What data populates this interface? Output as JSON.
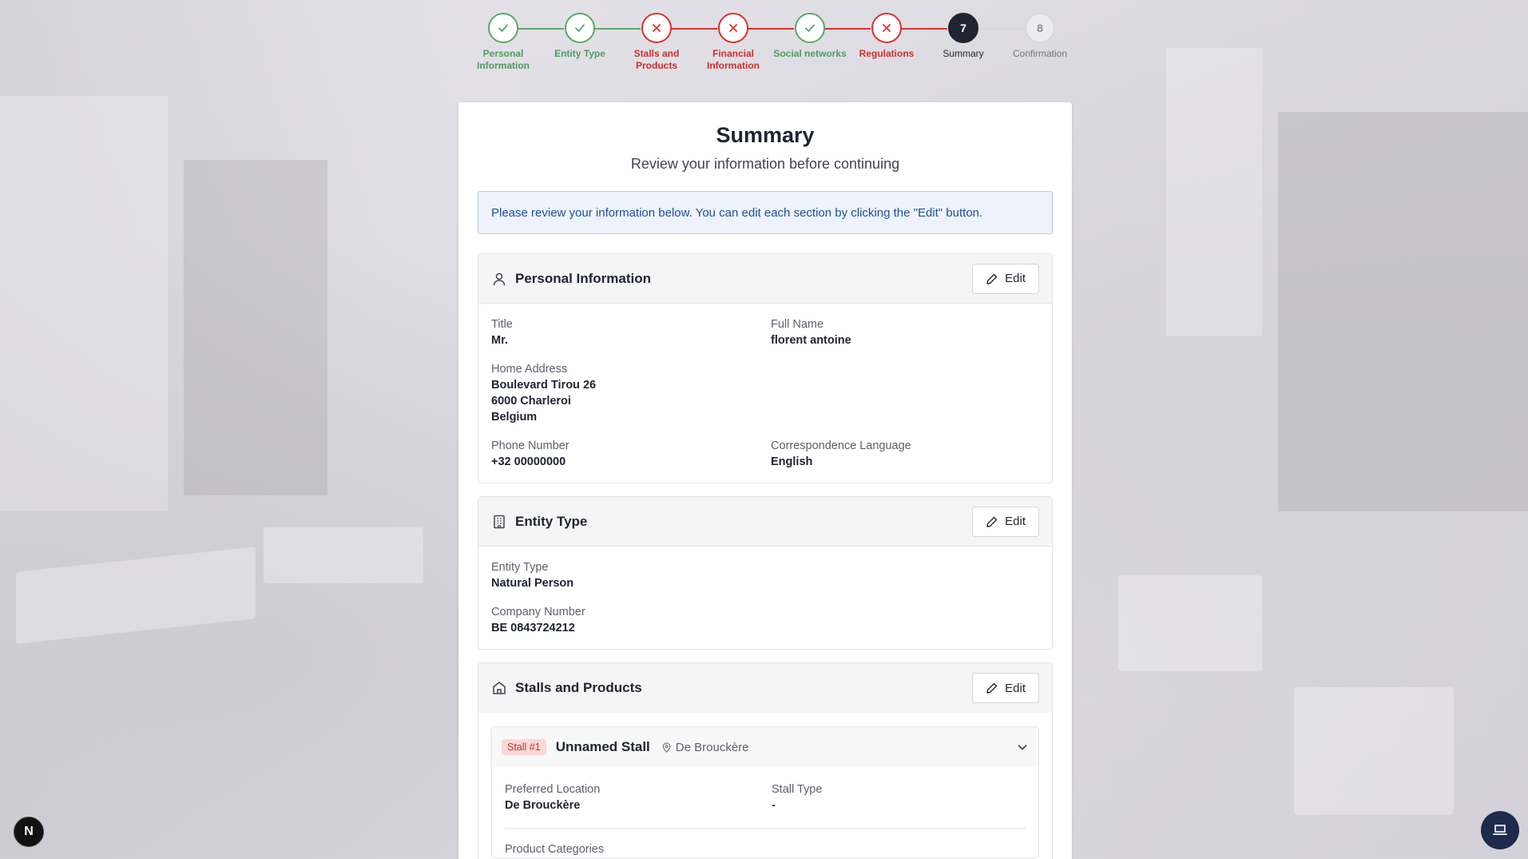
{
  "stepper": {
    "steps": [
      {
        "label": "Personal Information",
        "status": "ok",
        "marker": "check-icon"
      },
      {
        "label": "Entity Type",
        "status": "ok",
        "marker": "check-icon"
      },
      {
        "label": "Stalls and Products",
        "status": "error",
        "marker": "x-icon"
      },
      {
        "label": "Financial Information",
        "status": "error",
        "marker": "x-icon"
      },
      {
        "label": "Social networks",
        "status": "ok",
        "marker": "check-icon"
      },
      {
        "label": "Regulations",
        "status": "error",
        "marker": "x-icon"
      },
      {
        "label": "Summary",
        "status": "current",
        "number": "7"
      },
      {
        "label": "Confirmation",
        "status": "todo",
        "number": "8"
      }
    ]
  },
  "page": {
    "title": "Summary",
    "subtitle": "Review your information before continuing",
    "notice": "Please review your information below. You can edit each section by clicking the \"Edit\" button."
  },
  "edit_label": "Edit",
  "personal": {
    "heading": "Personal Information",
    "title_label": "Title",
    "title_value": "Mr.",
    "fullname_label": "Full Name",
    "fullname_value": "florent antoine",
    "address_label": "Home Address",
    "address_line1": "Boulevard Tirou 26",
    "address_line2": "6000 Charleroi",
    "address_line3": "Belgium",
    "phone_label": "Phone Number",
    "phone_value": "+32 00000000",
    "language_label": "Correspondence Language",
    "language_value": "English"
  },
  "entity": {
    "heading": "Entity Type",
    "type_label": "Entity Type",
    "type_value": "Natural Person",
    "company_label": "Company Number",
    "company_value": "BE 0843724212"
  },
  "stalls": {
    "heading": "Stalls and Products",
    "items": [
      {
        "badge": "Stall #1",
        "name": "Unnamed Stall",
        "location": "De Brouckère",
        "preferred_label": "Preferred Location",
        "preferred_value": "De Brouckère",
        "type_label": "Stall Type",
        "type_value": "-",
        "categories_label": "Product Categories"
      }
    ]
  },
  "fab_left_label": "N",
  "colors": {
    "ok": "#5aa86a",
    "error": "#d9332c",
    "current": "#1f2430",
    "notice_bg": "#eef3fb",
    "notice_text": "#1f4f9a",
    "badge_bg": "#f9d9d7",
    "badge_text": "#c0312b"
  }
}
